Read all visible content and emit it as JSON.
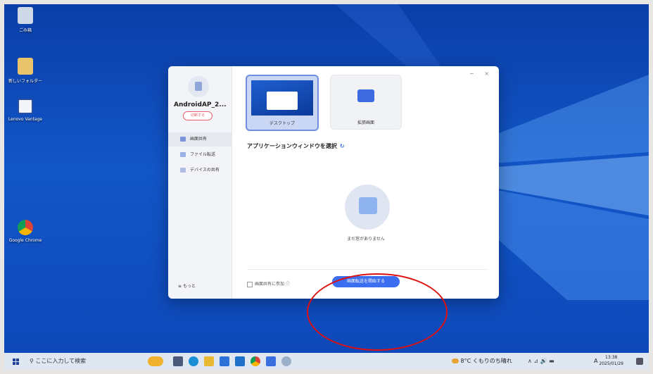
{
  "desktop": {
    "icons": [
      {
        "label": "ごみ箱",
        "icon": "recycle-bin-icon"
      },
      {
        "label": "新しいフォルダー",
        "icon": "folder-icon"
      },
      {
        "label": "Lenovo Vantage",
        "icon": "lenovo-vantage-icon"
      },
      {
        "label": "Google Chrome",
        "icon": "chrome-icon"
      }
    ]
  },
  "app": {
    "window_controls": "−  ×",
    "device_name": "AndroidAP_2...",
    "disconnect_label": "切断する",
    "nav": [
      {
        "label": "画面共有",
        "active": true
      },
      {
        "label": "ファイル転送",
        "active": false
      },
      {
        "label": "デバイスの共有",
        "active": false
      }
    ],
    "more_label": "もっと",
    "more_icon": "≡",
    "modes": [
      {
        "label": "デスクトップ",
        "selected": true
      },
      {
        "label": "拡張画面",
        "selected": false
      }
    ],
    "app_select_title": "アプリケーションウィンドウを選択",
    "refresh_icon": "↻",
    "empty_text": "まだ窓がありません",
    "join_label": "画面共有に参加",
    "info_icon": "ⓘ",
    "start_button_label": "画面転送を開始する",
    "accent_color": "#3c6ef0"
  },
  "taskbar": {
    "search_placeholder": "ここに入力して検索",
    "search_icon": "⚲",
    "weather": "8°C くもりのち晴れ",
    "tray_icons": "∧  ⊿  🔊  ▬",
    "ime": "A",
    "time": "13:38",
    "date": "2025/01/29",
    "notification_icon": "notification-icon"
  }
}
